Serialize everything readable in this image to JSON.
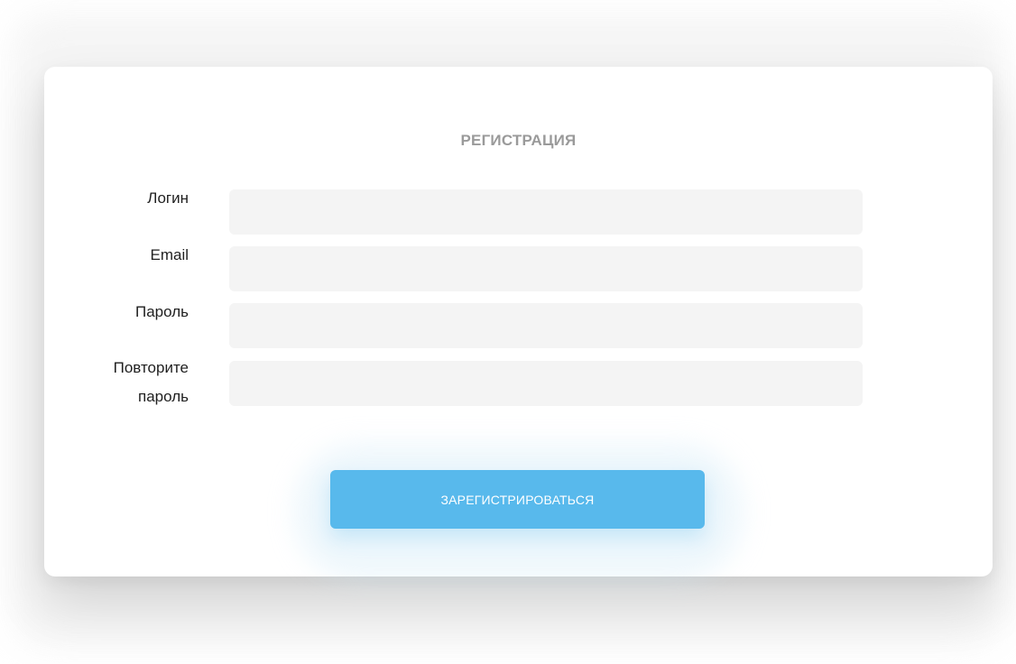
{
  "form": {
    "title": "РЕГИСТРАЦИЯ",
    "fields": [
      {
        "label": "Логин",
        "value": "",
        "placeholder": ""
      },
      {
        "label": "Email",
        "value": "",
        "placeholder": ""
      },
      {
        "label": "Пароль",
        "value": "",
        "placeholder": ""
      },
      {
        "label_line1": "Повторите",
        "label_line2": "пароль",
        "value": "",
        "placeholder": ""
      }
    ],
    "submit_label": "ЗАРЕГИСТРИРОВАТЬСЯ"
  },
  "colors": {
    "accent": "#58b9ec",
    "field_bg": "#f4f4f4",
    "title": "#9a9a9a"
  }
}
